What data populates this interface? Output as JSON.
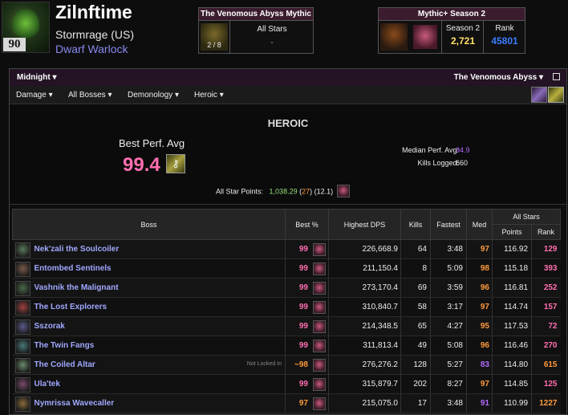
{
  "character": {
    "name": "Zilnftime",
    "realm": "Stormrage (US)",
    "spec_class": "Dwarf Warlock",
    "level": "90"
  },
  "raid_summary": {
    "title": "The Venomous Abyss Mythic",
    "progress": "2 / 8",
    "col_label": "All Stars",
    "col_value": "-"
  },
  "mplus_summary": {
    "title": "Mythic+ Season 2",
    "score_label": "Season 2",
    "score": "2,721",
    "rank_label": "Rank",
    "rank": "45801"
  },
  "toolbar": {
    "expansion": "Midnight",
    "zone": "The Venomous Abyss",
    "metric": "Damage",
    "bosses": "All Bosses",
    "spec": "Demonology",
    "difficulty": "Heroic"
  },
  "summary": {
    "difficulty_title": "HEROIC",
    "best_perf_label": "Best Perf. Avg",
    "best_perf_value": "99.4",
    "median_label": "Median Perf. Avg:",
    "median_value": "94.9",
    "kills_label": "Kills Logged:",
    "kills_value": "660",
    "allstar_label": "All Star Points:",
    "allstar_points": "1,038.29",
    "allstar_rank": "27",
    "allstar_pct": "12.1"
  },
  "table": {
    "headers": {
      "boss": "Boss",
      "best": "Best %",
      "dps": "Highest DPS",
      "kills": "Kills",
      "fastest": "Fastest",
      "med": "Med",
      "allstars": "All Stars",
      "points": "Points",
      "rank": "Rank"
    },
    "rows": [
      {
        "boss": "Nek'zali the Soulcoiler",
        "best": "99",
        "dps": "226,668.9",
        "kills": "64",
        "fastest": "3:48",
        "med": "97",
        "points": "116.92",
        "rank": "129",
        "icon_color": "#5a7a5a",
        "note": ""
      },
      {
        "boss": "Entombed Sentinels",
        "best": "99",
        "dps": "211,150.4",
        "kills": "8",
        "fastest": "5:09",
        "med": "98",
        "points": "115.18",
        "rank": "393",
        "icon_color": "#7a5a4a",
        "note": ""
      },
      {
        "boss": "Vashnik the Malignant",
        "best": "99",
        "dps": "273,170.4",
        "kills": "69",
        "fastest": "3:59",
        "med": "96",
        "points": "116.81",
        "rank": "252",
        "icon_color": "#4a6a4a",
        "note": ""
      },
      {
        "boss": "The Lost Explorers",
        "best": "99",
        "dps": "310,840.7",
        "kills": "58",
        "fastest": "3:17",
        "med": "97",
        "points": "114.74",
        "rank": "157",
        "icon_color": "#a04040",
        "note": ""
      },
      {
        "boss": "Sszorak",
        "best": "99",
        "dps": "214,348.5",
        "kills": "65",
        "fastest": "4:27",
        "med": "95",
        "points": "117.53",
        "rank": "72",
        "icon_color": "#5a5a8a",
        "note": ""
      },
      {
        "boss": "The Twin Fangs",
        "best": "99",
        "dps": "311,813.4",
        "kills": "49",
        "fastest": "5:08",
        "med": "96",
        "points": "116.46",
        "rank": "270",
        "icon_color": "#4a7a7a",
        "note": ""
      },
      {
        "boss": "The Coiled Altar",
        "best": "~98",
        "dps": "276,276.2",
        "kills": "128",
        "fastest": "5:27",
        "med": "83",
        "points": "114.80",
        "rank": "615",
        "icon_color": "#6a8a6a",
        "note": "Not Locked In"
      },
      {
        "boss": "Ula'tek",
        "best": "99",
        "dps": "315,879.7",
        "kills": "202",
        "fastest": "8:27",
        "med": "97",
        "points": "114.85",
        "rank": "125",
        "icon_color": "#7a4a6a",
        "note": ""
      },
      {
        "boss": "Nymrissa Wavecaller",
        "best": "97",
        "dps": "215,075.0",
        "kills": "17",
        "fastest": "3:48",
        "med": "91",
        "points": "110.99",
        "rank": "1227",
        "icon_color": "#8a6a3a",
        "note": ""
      }
    ]
  },
  "colors": {
    "pink": "#ff6fb0",
    "orange": "#ff9a3c",
    "purple": "#b36bff",
    "boss_name": "#a0a8ff",
    "class_color": "#8788ee",
    "score_color": "#ffe066",
    "rank_color": "#3c7dff"
  }
}
